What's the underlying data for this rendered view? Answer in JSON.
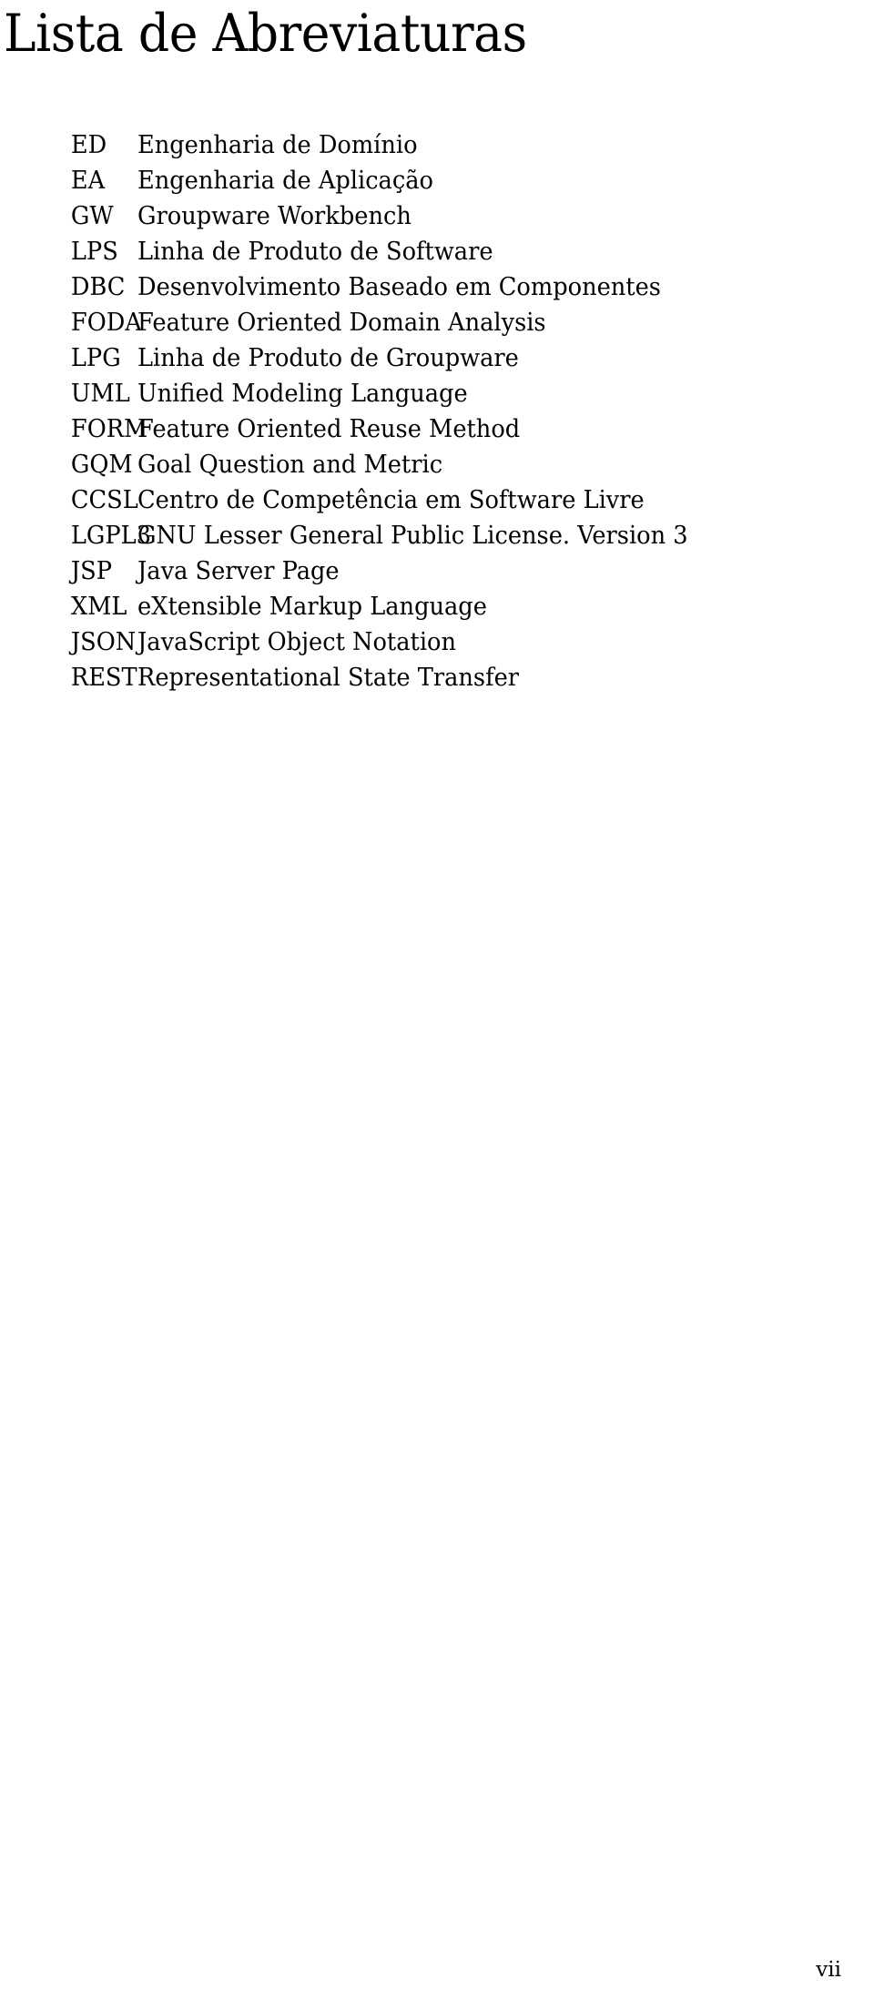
{
  "document": {
    "title": "Lista de Abreviaturas",
    "page_number": "vii",
    "text_color": "#000000",
    "background_color": "#ffffff"
  },
  "abbreviations": [
    {
      "term": "ED",
      "definition": "Engenharia de Domínio"
    },
    {
      "term": "EA",
      "definition": "Engenharia de Aplicação"
    },
    {
      "term": "GW",
      "definition": "Groupware Workbench"
    },
    {
      "term": "LPS",
      "definition": "Linha de Produto de Software"
    },
    {
      "term": "DBC",
      "definition": "Desenvolvimento Baseado em Componentes"
    },
    {
      "term": "FODA",
      "definition": "Feature Oriented Domain Analysis"
    },
    {
      "term": "LPG",
      "definition": "Linha de Produto de Groupware"
    },
    {
      "term": "UML",
      "definition": "Unified Modeling Language"
    },
    {
      "term": "FORM",
      "definition": "Feature Oriented Reuse Method"
    },
    {
      "term": "GQM",
      "definition": "Goal Question and Metric"
    },
    {
      "term": "CCSL",
      "definition": "Centro de Competência em Software Livre"
    },
    {
      "term": "LGPL3",
      "definition": "GNU Lesser General Public License. Version 3"
    },
    {
      "term": "JSP",
      "definition": "Java Server Page"
    },
    {
      "term": "XML",
      "definition": "eXtensible Markup Language"
    },
    {
      "term": "JSON",
      "definition": "JavaScript Object Notation"
    },
    {
      "term": "REST",
      "definition": "Representational State Transfer"
    }
  ]
}
